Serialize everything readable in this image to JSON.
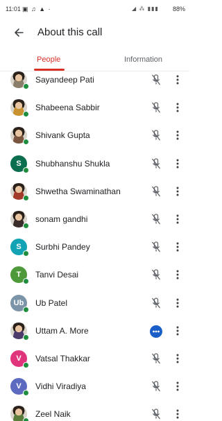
{
  "status_bar": {
    "time": "11:01",
    "left_icons": "▣ ♫ ▲ ·",
    "right_icons": "◢ ⁂ ▮▮▮",
    "battery": "88%"
  },
  "header": {
    "title": "About this call"
  },
  "tabs": {
    "people": "People",
    "information": "Information"
  },
  "accent_color": "#d93025",
  "participants": [
    {
      "name": "Sayandeep Pati",
      "avatar": "photo",
      "color": "#8a7d6a",
      "mic": "muted"
    },
    {
      "name": "Shabeena Sabbir",
      "avatar": "photo",
      "color": "#c7922f",
      "mic": "muted"
    },
    {
      "name": "Shivank Gupta",
      "avatar": "photo",
      "color": "#7a5640",
      "mic": "muted"
    },
    {
      "name": "Shubhanshu Shukla",
      "avatar": "S",
      "color": "#0b6e4f",
      "mic": "muted"
    },
    {
      "name": "Shwetha Swaminathan",
      "avatar": "photo",
      "color": "#a23b2a",
      "mic": "muted"
    },
    {
      "name": "sonam gandhi",
      "avatar": "photo",
      "color": "#3b2e2a",
      "mic": "muted"
    },
    {
      "name": "Surbhi Pandey",
      "avatar": "S",
      "color": "#12a4b5",
      "mic": "muted"
    },
    {
      "name": "Tanvi Desai",
      "avatar": "T",
      "color": "#4e9a3a",
      "mic": "muted"
    },
    {
      "name": "Ub Patel",
      "avatar": "Ub",
      "color": "#7c94a8",
      "mic": "muted"
    },
    {
      "name": "Uttam A. More",
      "avatar": "photo",
      "color": "#4a3b6b",
      "mic": "speaking"
    },
    {
      "name": "Vatsal Thakkar",
      "avatar": "V",
      "color": "#e0357c",
      "mic": "muted"
    },
    {
      "name": "Vidhi Viradiya",
      "avatar": "V",
      "color": "#5c6bc0",
      "mic": "muted"
    },
    {
      "name": "Zeel Naik",
      "avatar": "photo",
      "color": "#5a7d3c",
      "mic": "muted"
    }
  ]
}
